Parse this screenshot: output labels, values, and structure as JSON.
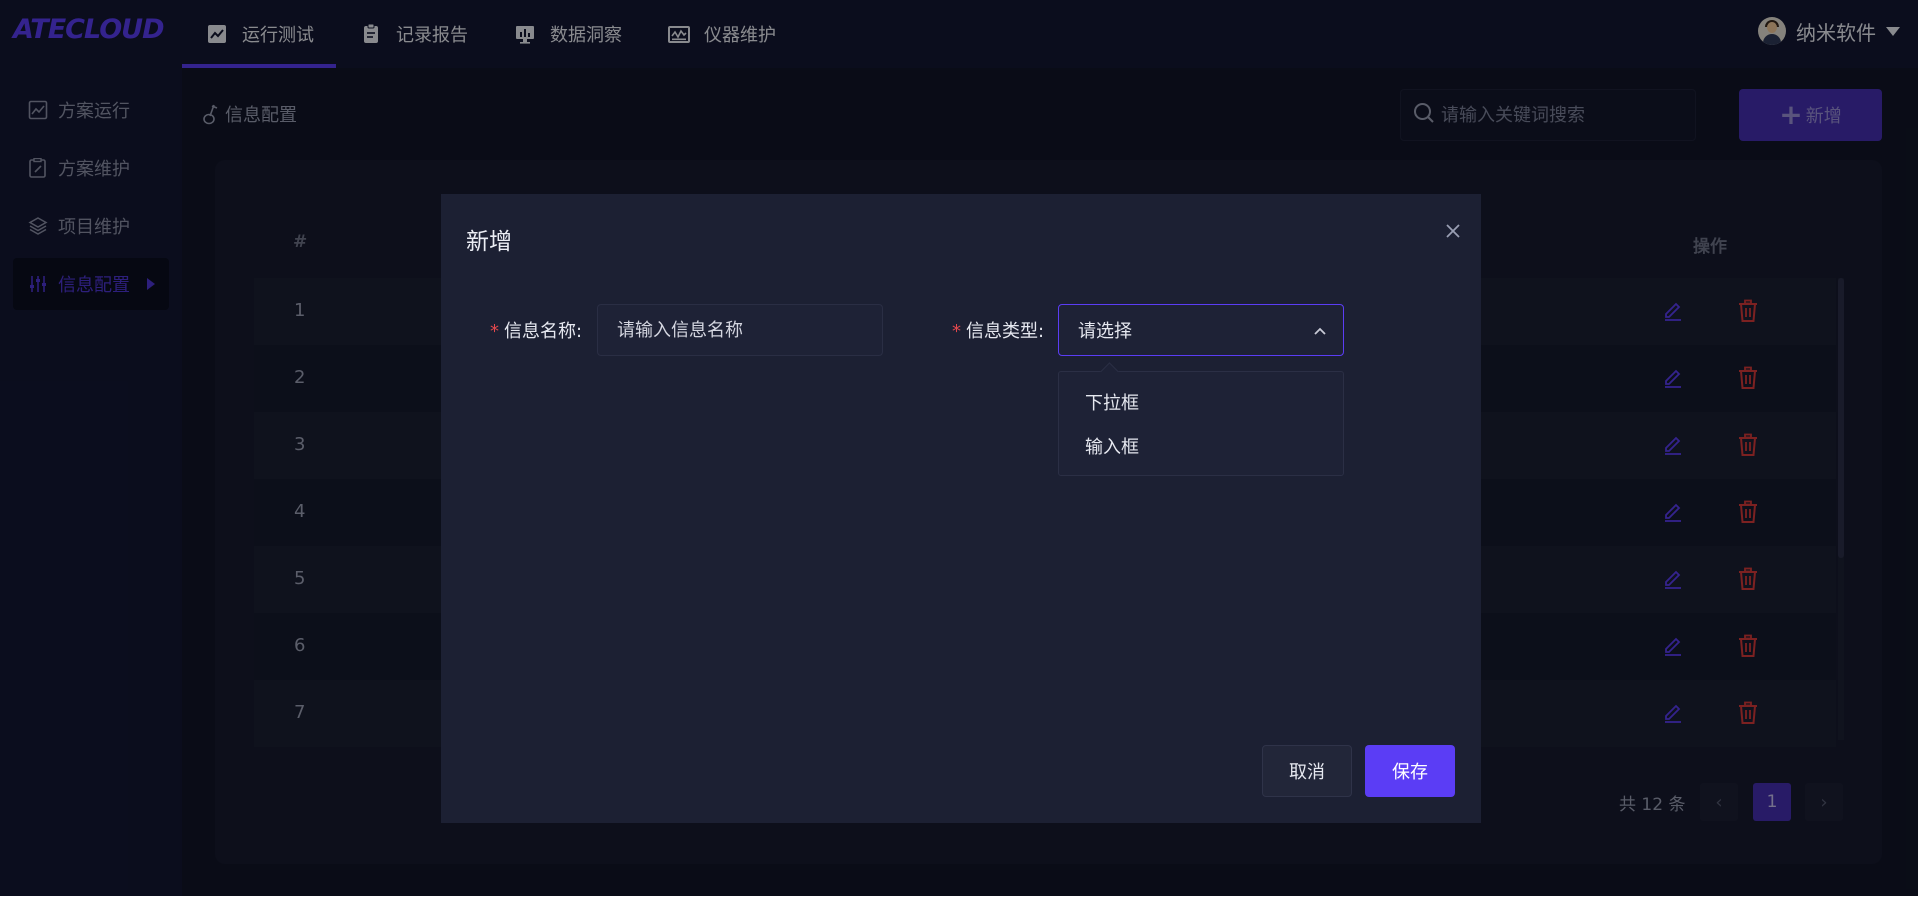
{
  "app": {
    "logo": "ATECLOUD"
  },
  "topnav": {
    "items": [
      {
        "label": "运行测试",
        "icon": "line-chart-icon",
        "active": true
      },
      {
        "label": "记录报告",
        "icon": "clipboard-icon",
        "active": false
      },
      {
        "label": "数据洞察",
        "icon": "monitor-chart-icon",
        "active": false
      },
      {
        "label": "仪器维护",
        "icon": "instrument-icon",
        "active": false
      }
    ]
  },
  "user": {
    "name": "纳米软件"
  },
  "sidebar": {
    "items": [
      {
        "label": "方案运行",
        "icon": "chart-box-icon",
        "active": false
      },
      {
        "label": "方案维护",
        "icon": "edit-doc-icon",
        "active": false
      },
      {
        "label": "项目维护",
        "icon": "layers-icon",
        "active": false
      },
      {
        "label": "信息配置",
        "icon": "sliders-icon",
        "active": true
      }
    ]
  },
  "main": {
    "breadcrumb": "信息配置",
    "search": {
      "placeholder": "请输入关键词搜索"
    },
    "add_button": "新增",
    "table": {
      "headers": {
        "index": "#",
        "actions": "操作"
      },
      "rows": [
        {
          "index": "1"
        },
        {
          "index": "2"
        },
        {
          "index": "3"
        },
        {
          "index": "4"
        },
        {
          "index": "5"
        },
        {
          "index": "6"
        },
        {
          "index": "7"
        }
      ]
    },
    "pagination": {
      "total": "共 12 条",
      "current_page": "1",
      "prev": "‹",
      "next": "›"
    }
  },
  "modal": {
    "title": "新增",
    "fields": {
      "name": {
        "required_mark": "*",
        "label": "信息名称:",
        "placeholder": "请输入信息名称"
      },
      "type": {
        "required_mark": "*",
        "label": "信息类型:",
        "value": "请选择"
      }
    },
    "dropdown_options": [
      "下拉框",
      "输入框"
    ],
    "cancel": "取消",
    "save": "保存"
  },
  "colors": {
    "accent": "#5b3df5",
    "delete": "#d63a3a",
    "background": "#121628"
  }
}
